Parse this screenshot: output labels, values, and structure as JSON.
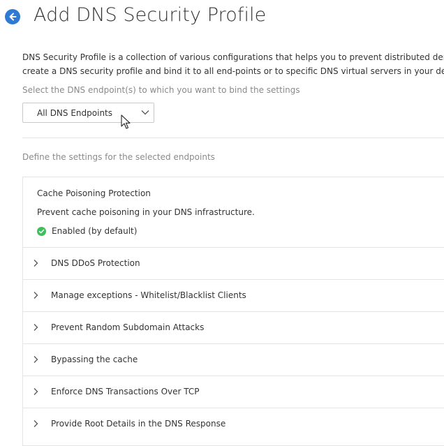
{
  "header": {
    "title": "Add DNS Security Profile"
  },
  "description": {
    "line1": "DNS Security Profile is a collection of various configurations that helps you to prevent distributed denial-of-servi",
    "line2": "create a DNS security profile and bind it to all end-points or to specific DNS virtual servers in your deployment."
  },
  "endpoint": {
    "label": "Select the DNS endpoint(s) to which you want to bind the settings",
    "selected": "All DNS Endpoints"
  },
  "settings": {
    "label": "Define the settings for the selected endpoints",
    "cache_poisoning": {
      "title": "Cache Poisoning Protection",
      "description": "Prevent cache poisoning in your DNS infrastructure.",
      "status": "Enabled (by default)"
    },
    "sections": [
      {
        "label": "DNS DDoS Protection"
      },
      {
        "label": "Manage exceptions - Whitelist/Blacklist Clients"
      },
      {
        "label": "Prevent Random Subdomain Attacks"
      },
      {
        "label": "Bypassing the cache"
      },
      {
        "label": "Enforce DNS Transactions Over TCP"
      },
      {
        "label": "Provide Root Details in the DNS Response"
      }
    ]
  },
  "colors": {
    "accent": "#2f7bd3",
    "success": "#3fbf5a",
    "border": "#e4e4e4",
    "muted_text": "#8a8a8a"
  },
  "icons": {
    "back": "arrow-left-icon",
    "dropdown": "chevron-down-icon",
    "section": "chevron-right-icon",
    "status": "check-circle-icon",
    "cursor": "mouse-cursor-icon"
  }
}
